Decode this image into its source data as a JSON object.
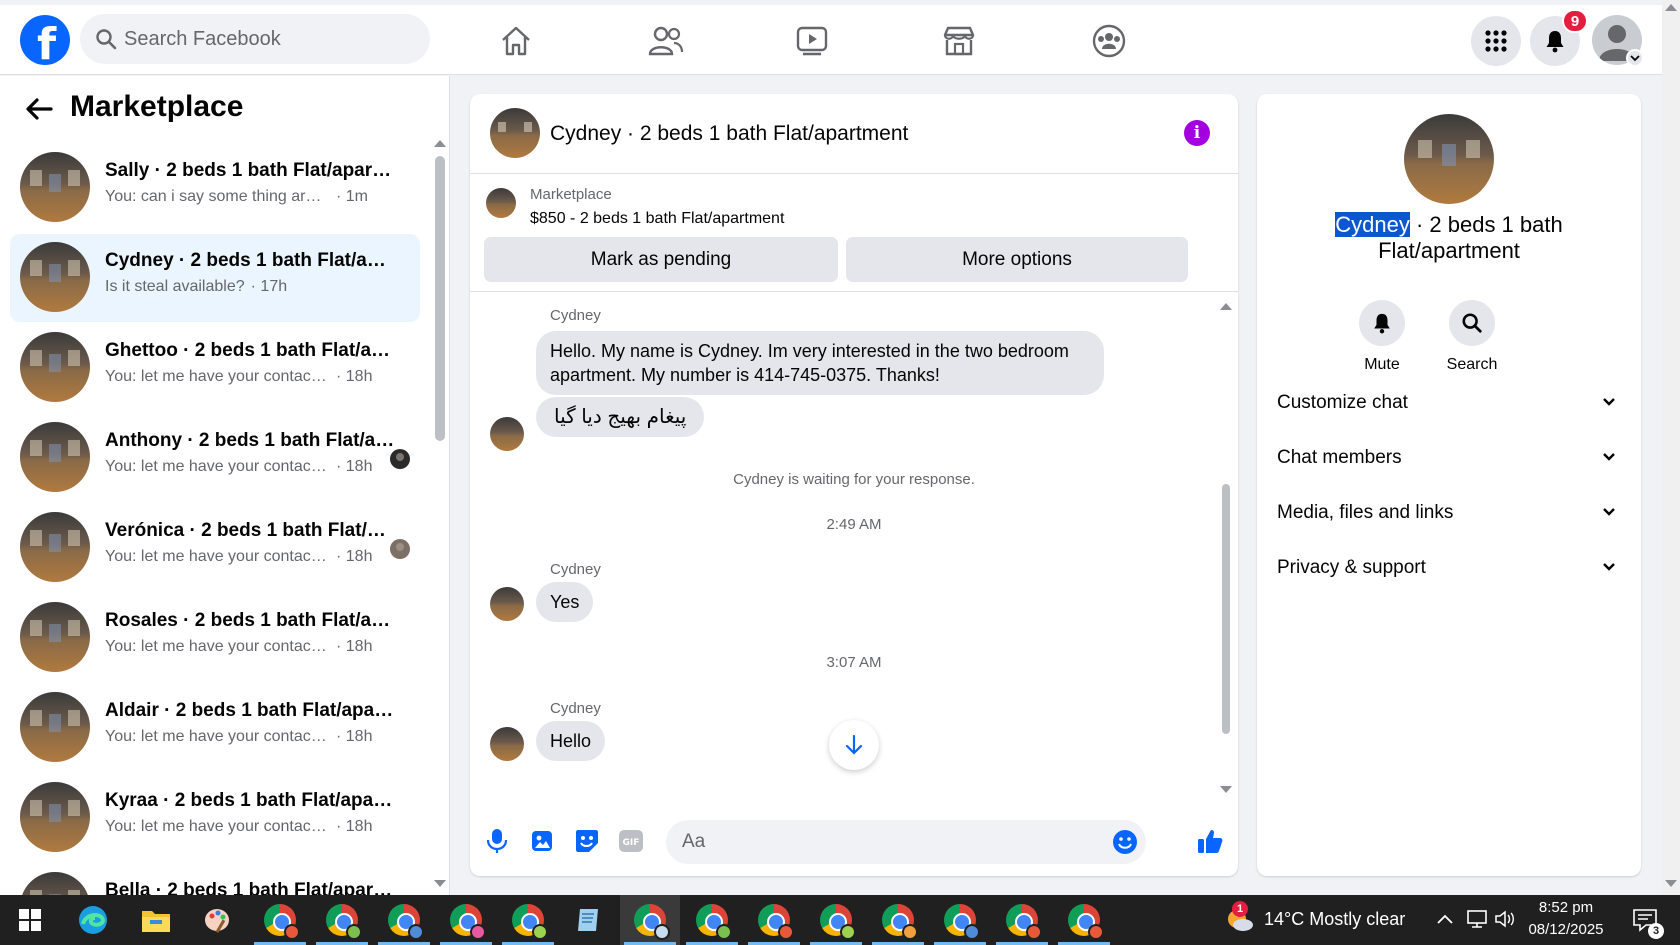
{
  "colors": {
    "brand": "#0866ff",
    "active_row": "#ebf5ff",
    "info_purple": "#a200e0",
    "badge_red": "#e41e3f"
  },
  "topbar": {
    "search_placeholder": "Search Facebook",
    "notification_count": "9",
    "icons": [
      "home-icon",
      "friends-icon",
      "video-icon",
      "marketplace-icon",
      "groups-icon",
      "menu-grid-icon",
      "bell-icon"
    ]
  },
  "sidebar": {
    "title": "Marketplace",
    "conversations": [
      {
        "name": "Sally · 2 beds 1 bath Flat/apartment",
        "preview": "You: can i say some thing are you ...",
        "time": "· 1m"
      },
      {
        "name": "Cydney · 2 beds 1 bath Flat/apartment",
        "preview": "Is it steal available?",
        "time": "· 17h"
      },
      {
        "name": "Ghettoo · 2 beds 1 bath Flat/apartment",
        "preview": "You: let me have your contact nu...",
        "time": "· 18h"
      },
      {
        "name": "Anthony · 2 beds 1 bath Flat/apartment",
        "preview": "You: let me have your contact n...",
        "time": "· 18h"
      },
      {
        "name": "Verónica · 2 beds 1 bath Flat/apartment",
        "preview": "You: let me have your contact n...",
        "time": "· 18h"
      },
      {
        "name": "Rosales · 2 beds 1 bath Flat/apartment",
        "preview": "You: let me have your contact nu...",
        "time": "· 18h"
      },
      {
        "name": "Aldair · 2 beds 1 bath Flat/apartment",
        "preview": "You: let me have your contact nu...",
        "time": "· 18h"
      },
      {
        "name": "Kyraa · 2 beds 1 bath Flat/apartment",
        "preview": "You: let me have your contact nu...",
        "time": "· 18h"
      },
      {
        "name": "Bella · 2 beds 1 bath Flat/apartment",
        "preview": "",
        "time": ""
      }
    ]
  },
  "chat": {
    "title": "Cydney · 2 beds 1 bath Flat/apartment",
    "listing_label": "Marketplace",
    "listing_price": "$850 - 2 beds 1 bath Flat/apartment",
    "mark_pending": "Mark as pending",
    "more_options": "More options",
    "messages": {
      "sender": "Cydney",
      "m1": "Hello.  My name is Cydney.  Im  very interested in the two bedroom apartment. My number is 414-745-0375. Thanks!",
      "m2": "پیغام بھیج دیا گیا",
      "waiting": "Cydney is waiting for your response.",
      "ts1": "2:49 AM",
      "m3": "Yes",
      "ts2": "3:07 AM",
      "m4": "Hello"
    },
    "composer_placeholder": "Aa"
  },
  "info_panel": {
    "name_highlight": "Cydney",
    "name_rest": " · 2 beds 1 bath Flat/apartment",
    "mute": "Mute",
    "search": "Search",
    "sections": [
      "Customize chat",
      "Chat members",
      "Media, files and links",
      "Privacy & support"
    ]
  },
  "taskbar": {
    "weather": "14°C  Mostly clear",
    "weather_badge": "1",
    "time": "8:52 pm",
    "date": "08/12/2025",
    "notif_count": "3"
  }
}
